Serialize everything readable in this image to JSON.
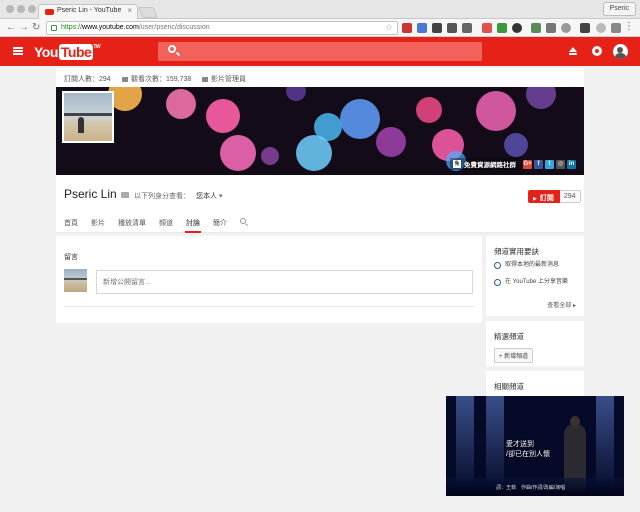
{
  "browser": {
    "tab_title": "Pseric Lin - YouTube",
    "profile": "Pseric",
    "url_scheme": "https://",
    "url_host": "www.youtube.com",
    "url_path": "/user/pseric/discussion"
  },
  "channel": {
    "stats": {
      "subscribers": "訂閱人數：294",
      "views": "觀看次數：159,738",
      "manager": "影片管理員"
    },
    "banner_site": "免費資源網路社群",
    "name": "Pseric Lin",
    "view_as_label": "以下列身分查看：",
    "view_as_value": "您本人",
    "subscribe_label": "訂閱",
    "subscriber_count": "294",
    "tabs": [
      "首頁",
      "影片",
      "播放清單",
      "頻道",
      "討論",
      "簡介"
    ]
  },
  "discussion": {
    "title": "留言",
    "placeholder": "新增公開留言..."
  },
  "sidebar": {
    "tips_title": "頻道實用要訣",
    "tips": [
      "取得本地的最新消息",
      "在 YouTube 上分享音樂"
    ],
    "see_all": "查看全部",
    "featured_title": "精選頻道",
    "add_channel": "+ 新增頻道",
    "related_title": "相關頻道"
  },
  "player": {
    "subtitle_line1": "愛才送到",
    "subtitle_line2": "/卻已在別人懷",
    "credits": "詞：王菲　作曲/作詞/改編/演唱"
  },
  "colors": {
    "youtube_red": "#e62117",
    "page_bg": "#f1f1f1",
    "tip_ring": "#2a5b95"
  }
}
